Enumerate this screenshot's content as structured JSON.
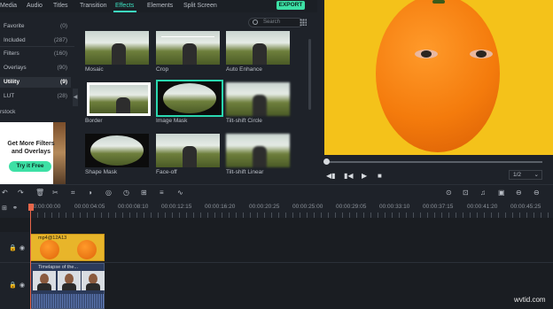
{
  "menu": {
    "items": [
      "Media",
      "Audio",
      "Titles",
      "Transition",
      "Effects",
      "Elements",
      "Split Screen"
    ],
    "export": "EXPORT"
  },
  "sidebar": {
    "items": [
      {
        "label": "Favorite",
        "count": "(0)"
      },
      {
        "label": "Included",
        "count": "(287)"
      },
      {
        "label": "Filters",
        "count": "(160)"
      },
      {
        "label": "Overlays",
        "count": "(90)"
      },
      {
        "label": "Utility",
        "count": "(9)"
      },
      {
        "label": "LUT",
        "count": "(28)"
      }
    ],
    "filmstock": "rstock",
    "promo_title": "Get More Filters and Overlays",
    "promo_button": "Try it Free"
  },
  "effects": {
    "search_placeholder": "Search",
    "items": [
      "Mosaic",
      "Crop",
      "Auto Enhance",
      "Border",
      "Image Mask",
      "Tilt-shift Circle",
      "Shape Mask",
      "Face-off",
      "Tilt-shift Linear"
    ]
  },
  "preview": {
    "page": "1/2"
  },
  "timeline": {
    "ticks": [
      "00:00:00:00",
      "00:00:04:05",
      "00:00:08:10",
      "00:00:12:15",
      "00:00:16:20",
      "00:00:20:25",
      "00:00:25:00",
      "00:00:29:05",
      "00:00:33:10",
      "00:00:37:15",
      "00:00:41:20",
      "00:00:45:25"
    ],
    "clip1_name": "mp4@12A13",
    "clip2_name": "Timelapse of the..."
  },
  "watermark": "wvtid.com",
  "colors": {
    "accent": "#3de0c0",
    "export": "#3de0a5",
    "playhead": "#e8664a"
  }
}
